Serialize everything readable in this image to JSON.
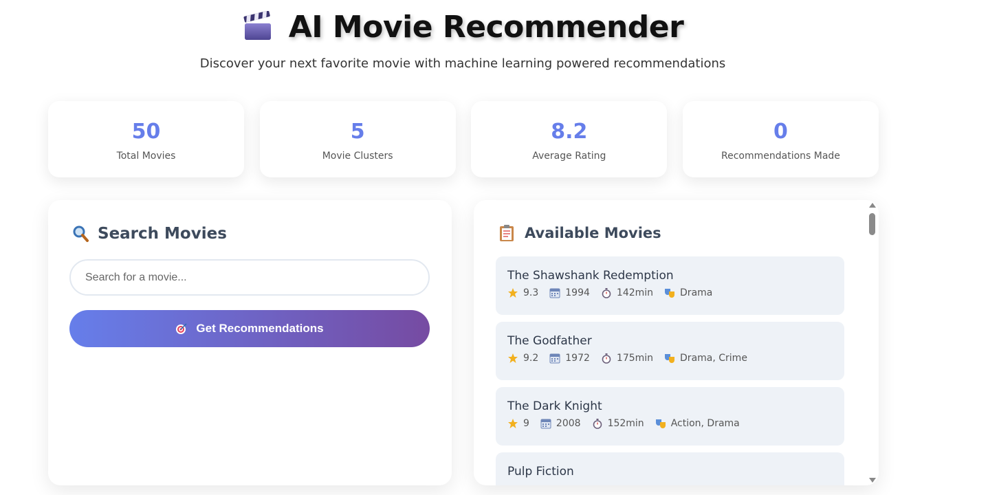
{
  "header": {
    "title": "AI Movie Recommender",
    "subtitle": "Discover your next favorite movie with machine learning powered recommendations",
    "title_icon": "clapperboard-icon"
  },
  "stats": [
    {
      "value": "50",
      "label": "Total Movies"
    },
    {
      "value": "5",
      "label": "Movie Clusters"
    },
    {
      "value": "8.2",
      "label": "Average Rating"
    },
    {
      "value": "0",
      "label": "Recommendations Made"
    }
  ],
  "search": {
    "heading": "Search Movies",
    "heading_icon": "magnifier-icon",
    "placeholder": "Search for a movie...",
    "value": "",
    "button_label": "Get Recommendations",
    "button_icon": "target-icon"
  },
  "movies": {
    "heading": "Available Movies",
    "heading_icon": "clipboard-icon",
    "items": [
      {
        "title": "The Shawshank Redemption",
        "rating": "9.3",
        "year": "1994",
        "runtime": "142min",
        "genres": "Drama"
      },
      {
        "title": "The Godfather",
        "rating": "9.2",
        "year": "1972",
        "runtime": "175min",
        "genres": "Drama, Crime"
      },
      {
        "title": "The Dark Knight",
        "rating": "9",
        "year": "2008",
        "runtime": "152min",
        "genres": "Action, Drama"
      },
      {
        "title": "Pulp Fiction",
        "rating": "",
        "year": "",
        "runtime": "",
        "genres": ""
      }
    ]
  },
  "colors": {
    "accent": "#667eea",
    "gradient_start": "#667eea",
    "gradient_end": "#764ba2",
    "card_bg": "#eef2f7"
  }
}
